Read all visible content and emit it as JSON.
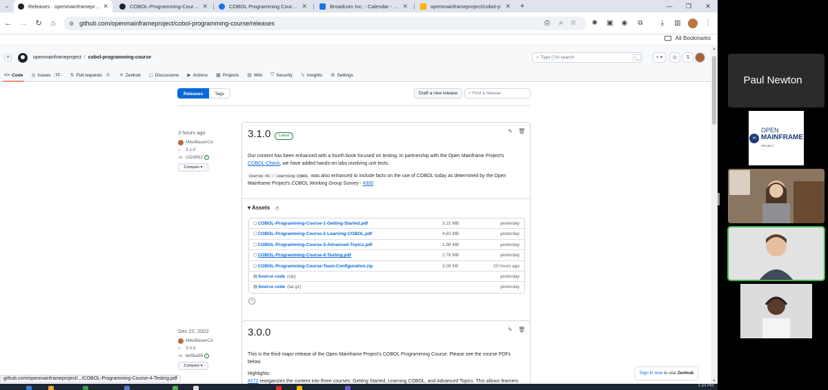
{
  "browser": {
    "tabs": [
      {
        "title": "Releases · openmainframeproje",
        "active": true,
        "color": "#1f2328"
      },
      {
        "title": "COBOL-Programming-Course-",
        "active": false,
        "color": "#1f2328"
      },
      {
        "title": "COBOL Programming Course O",
        "active": false,
        "color": "#1a73e8"
      },
      {
        "title": "Broadcom Inc. - Calendar - We",
        "active": false,
        "color": "#1a73e8"
      },
      {
        "title": "openmainframeproject/cobol-p",
        "active": false,
        "color": "#f4b400"
      }
    ],
    "url": "github.com/openmainframeproject/cobol-programming-course/releases",
    "all_bookmarks": "All Bookmarks",
    "status_url": "github.com/openmainframeproject/.../COBOL-Programming-Course-4-Testing.pdf"
  },
  "github": {
    "owner": "openmainframeproject",
    "repo": "cobol-programming-course",
    "search_placeholder_pre": "Type",
    "search_kbd": "/",
    "search_placeholder_post": "to search",
    "nav": [
      {
        "label": "Code",
        "icon": "<>",
        "count": "",
        "selected": true
      },
      {
        "label": "Issues",
        "icon": "◎",
        "count": "12",
        "selected": false
      },
      {
        "label": "Pull requests",
        "icon": "⇅",
        "count": "1",
        "selected": false
      },
      {
        "label": "Zenhub",
        "icon": "✳",
        "count": "",
        "selected": false
      },
      {
        "label": "Discussions",
        "icon": "◻",
        "count": "",
        "selected": false
      },
      {
        "label": "Actions",
        "icon": "▶",
        "count": "",
        "selected": false
      },
      {
        "label": "Projects",
        "icon": "▦",
        "count": "",
        "selected": false
      },
      {
        "label": "Wiki",
        "icon": "▤",
        "count": "",
        "selected": false
      },
      {
        "label": "Security",
        "icon": "⛉",
        "count": "",
        "selected": false
      },
      {
        "label": "Insights",
        "icon": "∿",
        "count": "",
        "selected": false
      },
      {
        "label": "Settings",
        "icon": "⚙",
        "count": "",
        "selected": false
      }
    ],
    "releases_tab": "Releases",
    "tags_tab": "Tags",
    "draft_button": "Draft a new release",
    "find_placeholder": "Find a release"
  },
  "release1": {
    "when": "3 hours ago",
    "author": "MikeBauerCA",
    "tag": "3.1.0",
    "commit": "c32d5b2",
    "compare": "Compare",
    "title": "3.1.0",
    "badge": "Latest",
    "para1_a": "Our content has been enhanced with a fourth book focused on testing. In partnership with the Open Mainframe Project's",
    "para1_link": "COBOL-Check",
    "para1_b": ", we have added hands-on labs involving unit tests.",
    "para2_code": "Course #2 - Learning COBOL",
    "para2_a": " was also enhanced to include facts on the use of COBOL today as determined by the Open Mainframe Project's COBOL Working Group Survey -",
    "para2_link": "#300",
    "assets_label": "Assets",
    "assets_count": "7",
    "assets": [
      {
        "name": "COBOL-Programming-Course-1-Getting-Started.pdf",
        "size": "3.22 MB",
        "date": "yesterday",
        "ext": ""
      },
      {
        "name": "COBOL-Programming-Course-2-Learning-COBOL.pdf",
        "size": "4.83 MB",
        "date": "yesterday",
        "ext": ""
      },
      {
        "name": "COBOL-Programming-Course-3-Advanced-Topics.pdf",
        "size": "1.98 MB",
        "date": "yesterday",
        "ext": ""
      },
      {
        "name": "COBOL-Programming-Course-4-Testing.pdf",
        "size": "2.78 MB",
        "date": "yesterday",
        "ext": ""
      },
      {
        "name": "COBOL-Programming-Course-Team-Configuration.zip",
        "size": "3.09 KB",
        "date": "20 hours ago",
        "ext": ""
      },
      {
        "name": "Source code",
        "size": "",
        "date": "yesterday",
        "ext": "(zip)"
      },
      {
        "name": "Source code",
        "size": "",
        "date": "yesterday",
        "ext": "(tar.gz)"
      }
    ]
  },
  "release2": {
    "when": "Dec 22, 2022",
    "author": "MikeBauerCA",
    "tag": "3.0.0",
    "commit": "be5ba59",
    "compare": "Compare",
    "title": "3.0.0",
    "para1": "This is the third major release of the Open Mainframe Project's COBOL Programming Course. Please see the course PDFs below.",
    "highlights": "Highlights:",
    "hl_link": "#272",
    "hl_text": " reorganizes the content into three courses: Getting Started, Learning COBOL, and Advanced Topics. This allows learners"
  },
  "zenhub": {
    "link": "Sign in now",
    "text": " to use ",
    "brand": "Zenhub"
  },
  "taskbar": {
    "clock": "1:10 PM"
  },
  "video": {
    "presenter_name": "Paul Newton",
    "logo_top": "OPEN",
    "logo_bottom": "MAINFRAME",
    "logo_sub": "PROJECT"
  },
  "colors": {
    "accent": "#0969da",
    "speaking": "#3ab54a",
    "latest": "#1a7f37"
  }
}
